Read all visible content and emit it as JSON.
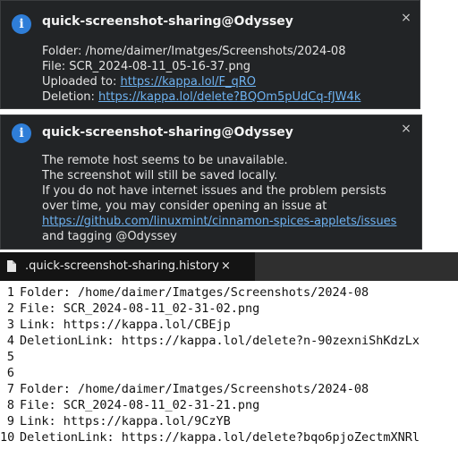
{
  "notification1": {
    "title": "quick-screenshot-sharing@Odyssey",
    "lines": [
      {
        "label": "Folder: /home/daimer/Imatges/Screenshots/2024-08"
      },
      {
        "label": "File: SCR_2024-08-11_05-16-37.png"
      }
    ],
    "uploaded_label": "Uploaded to: ",
    "uploaded_link": "https://kappa.lol/F_qRO",
    "deletion_label": "Deletion: ",
    "deletion_link": "https://kappa.lol/delete?BQOm5pUdCq-fJW4k",
    "close_glyph": "×"
  },
  "notification2": {
    "title": "quick-screenshot-sharing@Odyssey",
    "line1": "The remote host seems to be unavailable.",
    "line2": "The screenshot will still be saved locally.",
    "line3": "If you do not have internet issues and the problem persists over time, you may consider opening an issue at ",
    "issue_link": "https://github.com/linuxmint/cinnamon-spices-applets/issues",
    "line3_tail": " and tagging @Odyssey",
    "close_glyph": "×"
  },
  "editor": {
    "tab_label": ".quick-screenshot-sharing.history",
    "tab_close": "×",
    "lines": [
      {
        "num": "1",
        "text": "Folder: /home/daimer/Imatges/Screenshots/2024-08"
      },
      {
        "num": "2",
        "text": "File: SCR_2024-08-11_02-31-02.png"
      },
      {
        "num": "3",
        "text": "Link: https://kappa.lol/CBEjp"
      },
      {
        "num": "4",
        "text": "DeletionLink: https://kappa.lol/delete?n-90zexniShKdzLx"
      },
      {
        "num": "5",
        "text": ""
      },
      {
        "num": "6",
        "text": ""
      },
      {
        "num": "7",
        "text": "Folder: /home/daimer/Imatges/Screenshots/2024-08"
      },
      {
        "num": "8",
        "text": "File: SCR_2024-08-11_02-31-21.png"
      },
      {
        "num": "9",
        "text": "Link: https://kappa.lol/9CzYB"
      },
      {
        "num": "10",
        "text": "DeletionLink: https://kappa.lol/delete?bqo6pjoZectmXNRl"
      }
    ]
  }
}
